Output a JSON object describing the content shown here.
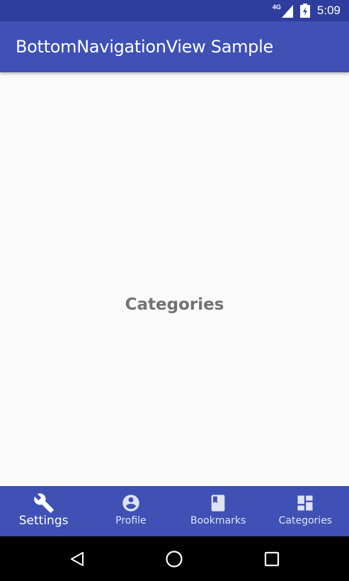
{
  "status_bar": {
    "network_type": "4G",
    "time": "5:09",
    "icons": [
      "signal-icon",
      "battery-icon"
    ]
  },
  "app_bar": {
    "title": "BottomNavigationView Sample"
  },
  "content": {
    "label": "Categories"
  },
  "bottom_nav": {
    "items": [
      {
        "label": "Settings",
        "icon": "wrench-icon",
        "active": true
      },
      {
        "label": "Profile",
        "icon": "account-circle-icon",
        "active": false
      },
      {
        "label": "Bookmarks",
        "icon": "book-icon",
        "active": false
      },
      {
        "label": "Categories",
        "icon": "dashboard-icon",
        "active": false
      }
    ]
  },
  "system_nav": {
    "buttons": [
      "back-icon",
      "home-icon",
      "recents-icon"
    ]
  },
  "colors": {
    "primary": "#3f51b5",
    "primary_dark": "#2f3e9e",
    "background": "#fafafa",
    "content_text": "#737373"
  }
}
